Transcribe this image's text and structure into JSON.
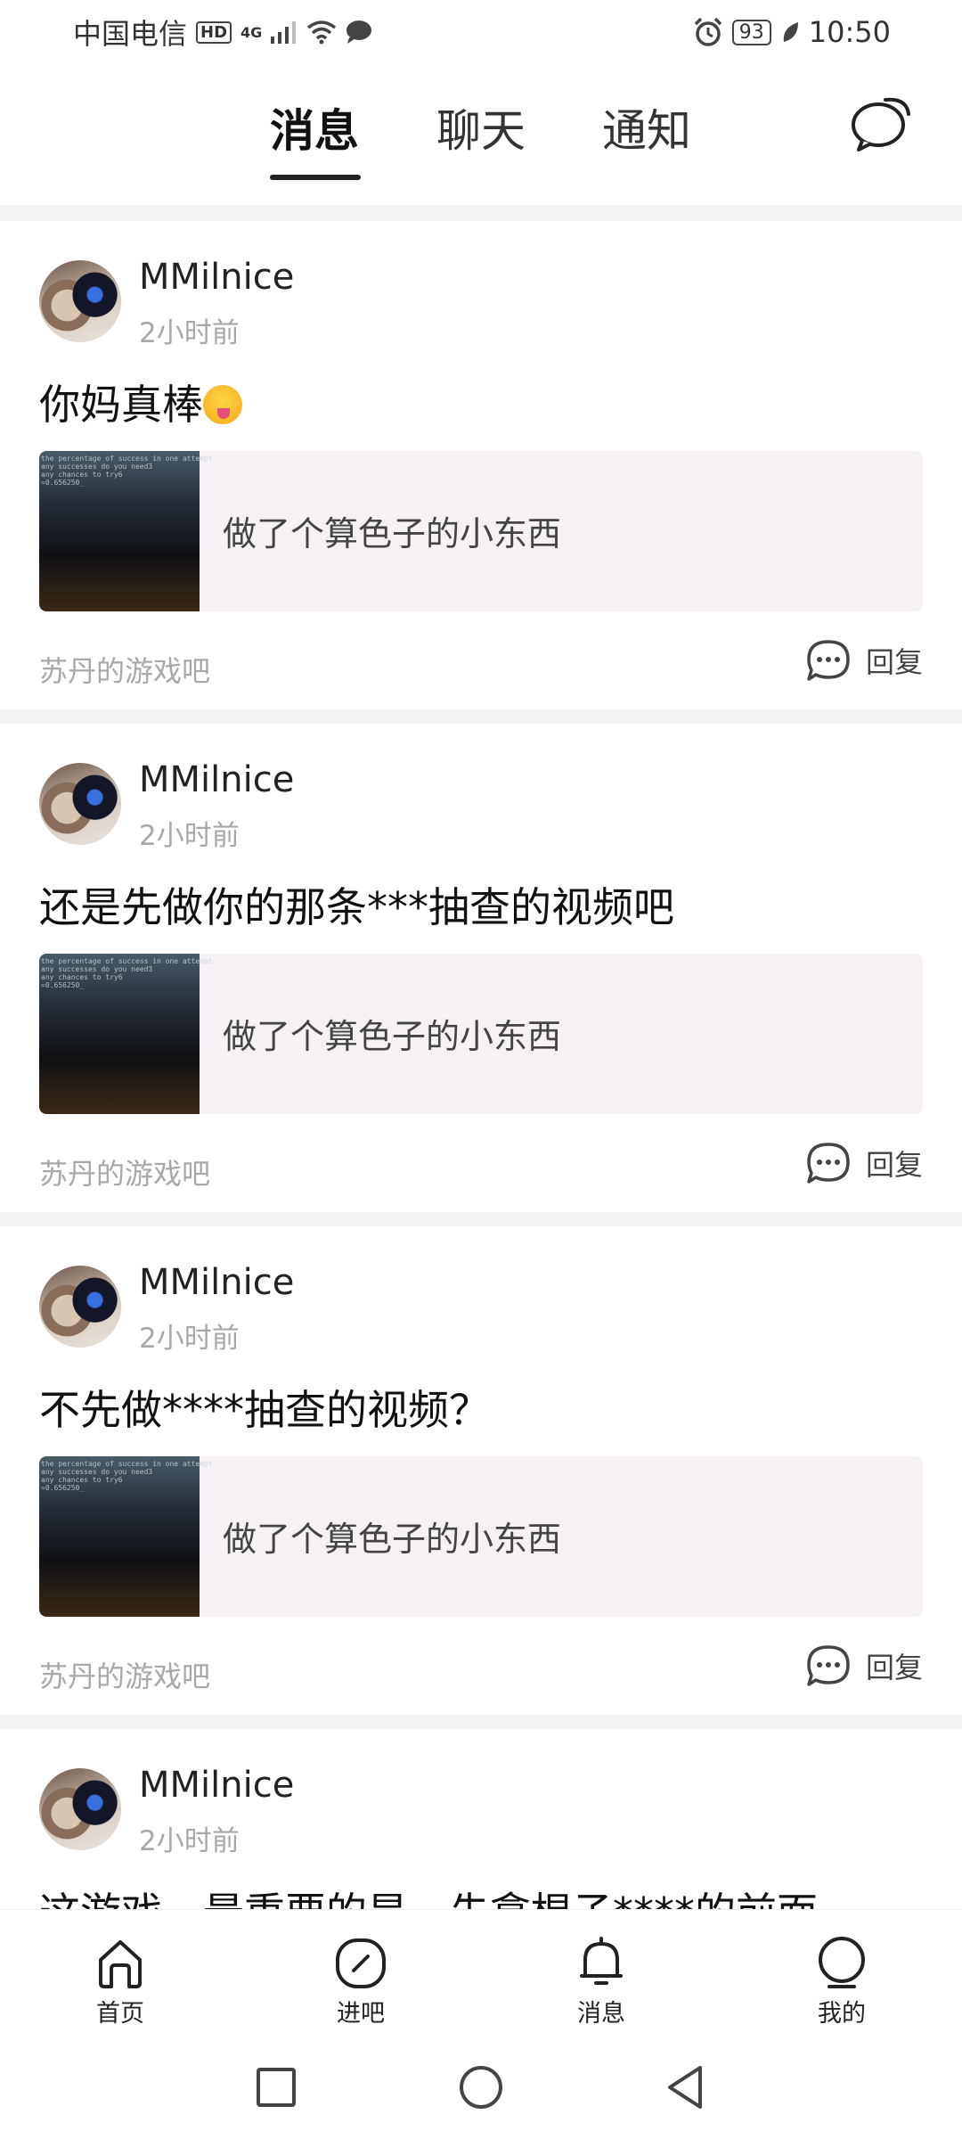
{
  "status_bar": {
    "carrier": "中国电信",
    "hd": "HD",
    "network": "4G",
    "battery": "93",
    "time": "10:50"
  },
  "tabs": [
    {
      "label": "消息",
      "active": true
    },
    {
      "label": "聊天",
      "active": false
    },
    {
      "label": "通知",
      "active": false
    }
  ],
  "feed": [
    {
      "user": "MMilnice",
      "time": "2小时前",
      "message": "你妈真棒",
      "has_emoji": true,
      "quote": "做了个算色子的小东西",
      "forum": "苏丹的游戏吧",
      "reply_label": "回复"
    },
    {
      "user": "MMilnice",
      "time": "2小时前",
      "message": "还是先做你的那条***抽查的视频吧",
      "quote": "做了个算色子的小东西",
      "forum": "苏丹的游戏吧",
      "reply_label": "回复"
    },
    {
      "user": "MMilnice",
      "time": "2小时前",
      "message": "不先做****抽查的视频？",
      "quote": "做了个算色子的小东西",
      "forum": "苏丹的游戏吧",
      "reply_label": "回复"
    },
    {
      "user": "MMilnice",
      "time": "2小时前",
      "message": "这游戏，最重要的是，先拿棍子****的前面"
    }
  ],
  "bottom_nav": [
    {
      "label": "首页",
      "icon": "home-icon"
    },
    {
      "label": "进吧",
      "icon": "compass-icon"
    },
    {
      "label": "消息",
      "icon": "bell-icon"
    },
    {
      "label": "我的",
      "icon": "profile-icon"
    }
  ],
  "colors": {
    "background": "#f5f2f5",
    "quote_bg": "#f6f1f5",
    "muted_text": "#a8a8a8"
  }
}
